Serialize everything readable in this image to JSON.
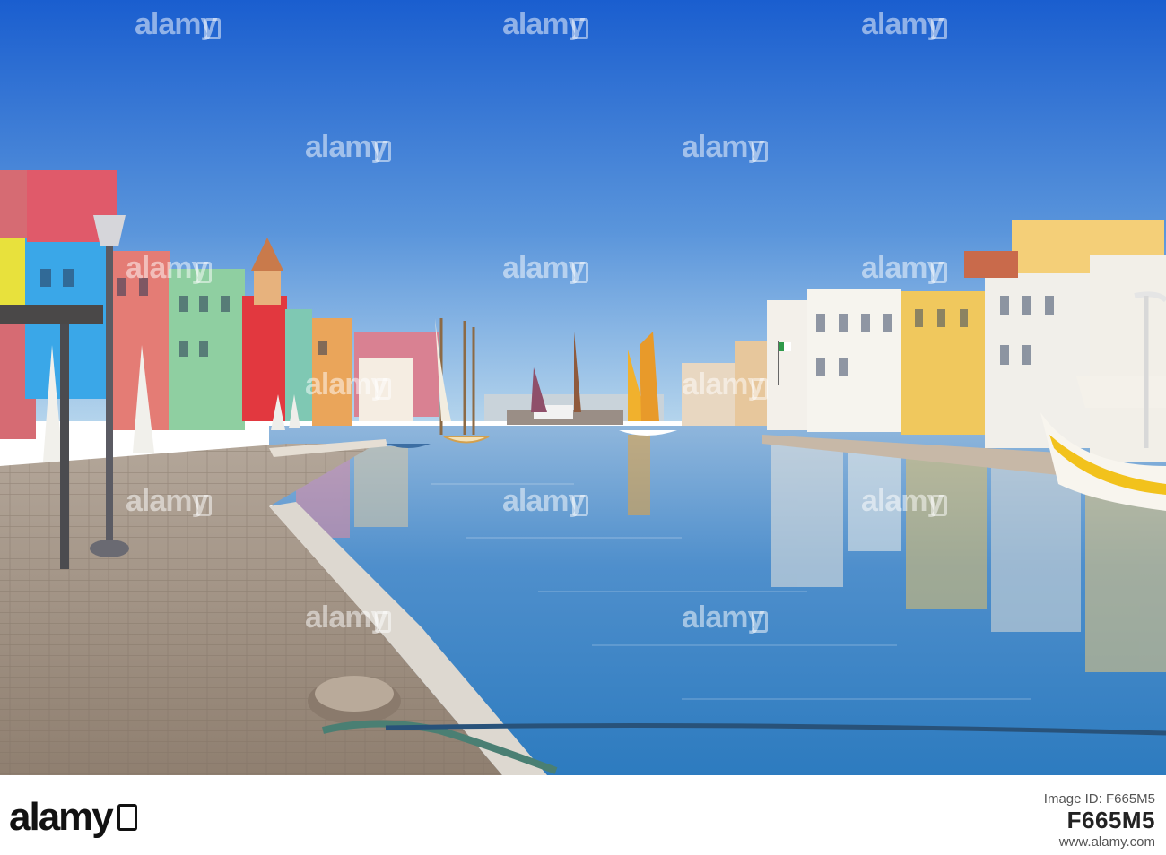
{
  "watermark": {
    "text": "alamy"
  },
  "footer": {
    "brand": "alamy",
    "image_id_label": "Image ID: F665M5",
    "image_id": "F665M5",
    "url": "www.alamy.com"
  },
  "colors": {
    "sky_top": "#1a5ecf",
    "sky_bottom": "#a9cde9",
    "water": "#4f8fcc",
    "pavement": "#a89888"
  }
}
